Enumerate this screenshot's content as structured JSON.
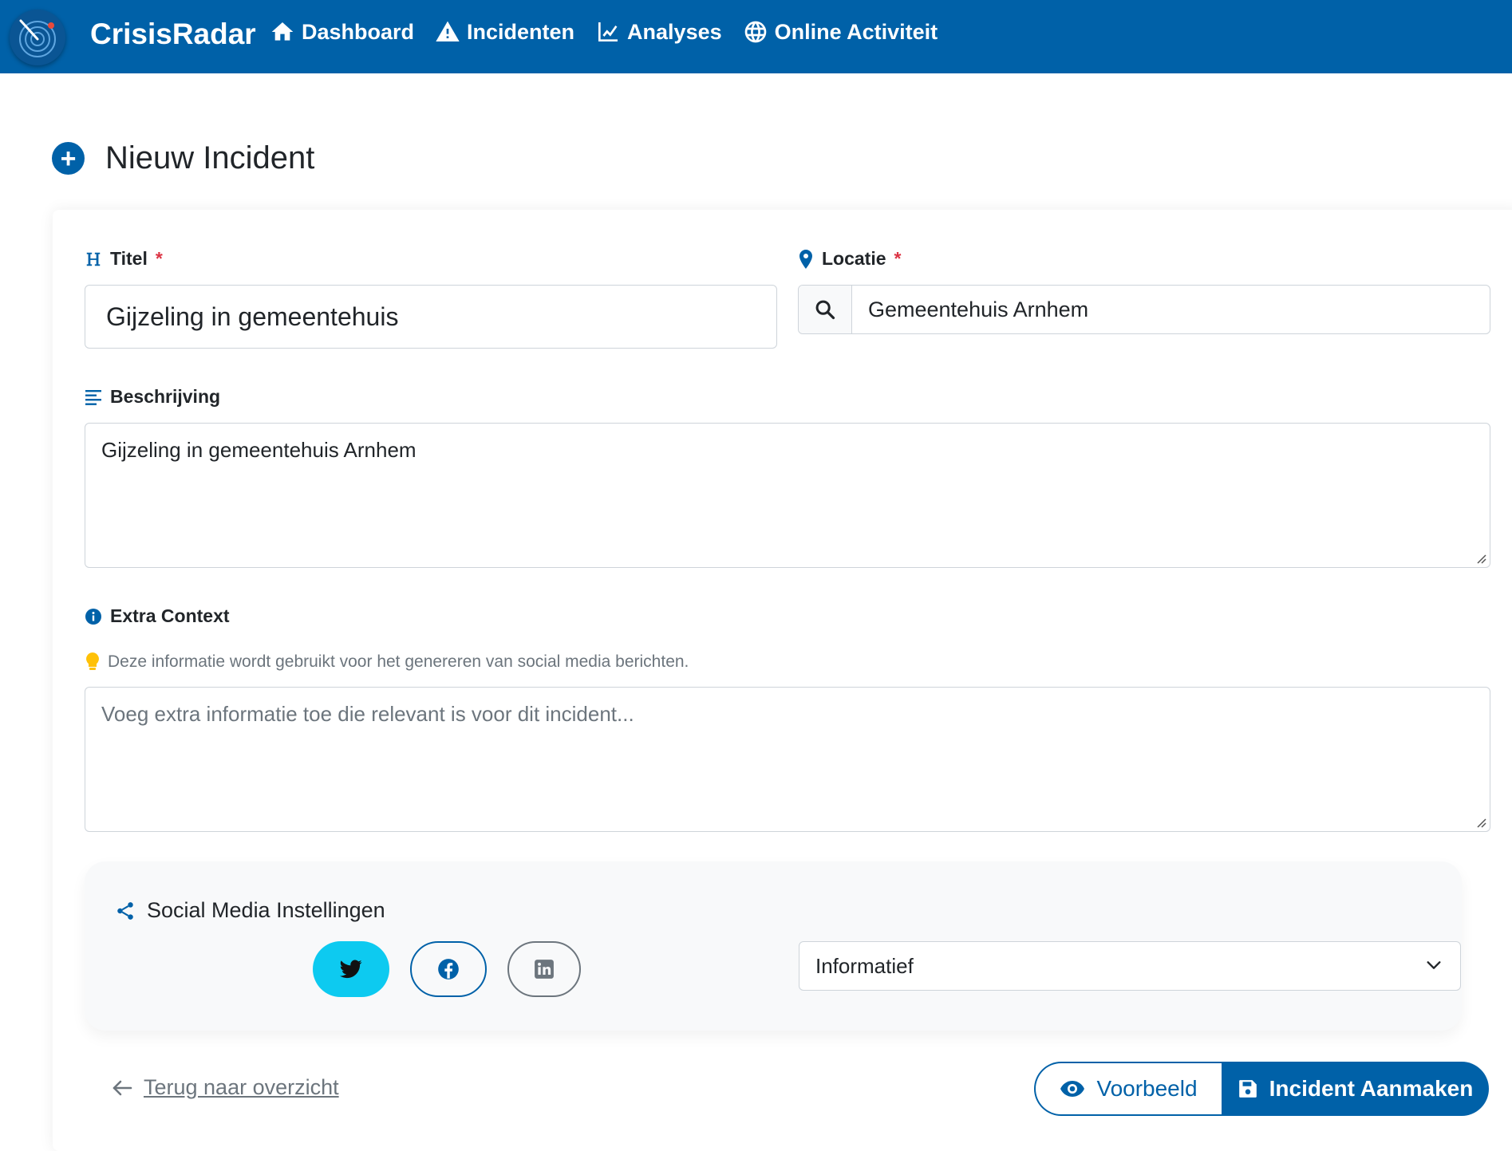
{
  "nav": {
    "brand": "CrisisRadar",
    "items": [
      {
        "label": "Dashboard",
        "icon": "home-icon"
      },
      {
        "label": "Incidenten",
        "icon": "warning-icon"
      },
      {
        "label": "Analyses",
        "icon": "chart-line-icon"
      },
      {
        "label": "Online Activiteit",
        "icon": "globe-icon"
      }
    ]
  },
  "page": {
    "title": "Nieuw Incident"
  },
  "form": {
    "title_label": "Titel",
    "title_value": "Gijzeling in gemeentehuis",
    "location_label": "Locatie",
    "location_value": "Gemeentehuis Arnhem",
    "required_mark": "*",
    "description_label": "Beschrijving",
    "description_value": "Gijzeling in gemeentehuis Arnhem",
    "context_label": "Extra Context",
    "context_hint": "Deze informatie wordt gebruikt voor het genereren van social media berichten.",
    "context_placeholder": "Voeg extra informatie toe die relevant is voor dit incident..."
  },
  "social": {
    "title": "Social Media Instellingen",
    "platforms": [
      "twitter",
      "facebook",
      "linkedin"
    ],
    "selected_platform": "twitter",
    "tone_selected": "Informatief"
  },
  "footer": {
    "back_label": "Terug naar overzicht",
    "preview_label": "Voorbeeld",
    "create_label": "Incident Aanmaken"
  },
  "colors": {
    "primary": "#0061a8",
    "twitter_active": "#0dcaf0",
    "required": "#dc3545",
    "hint_bulb": "#ffc107"
  }
}
